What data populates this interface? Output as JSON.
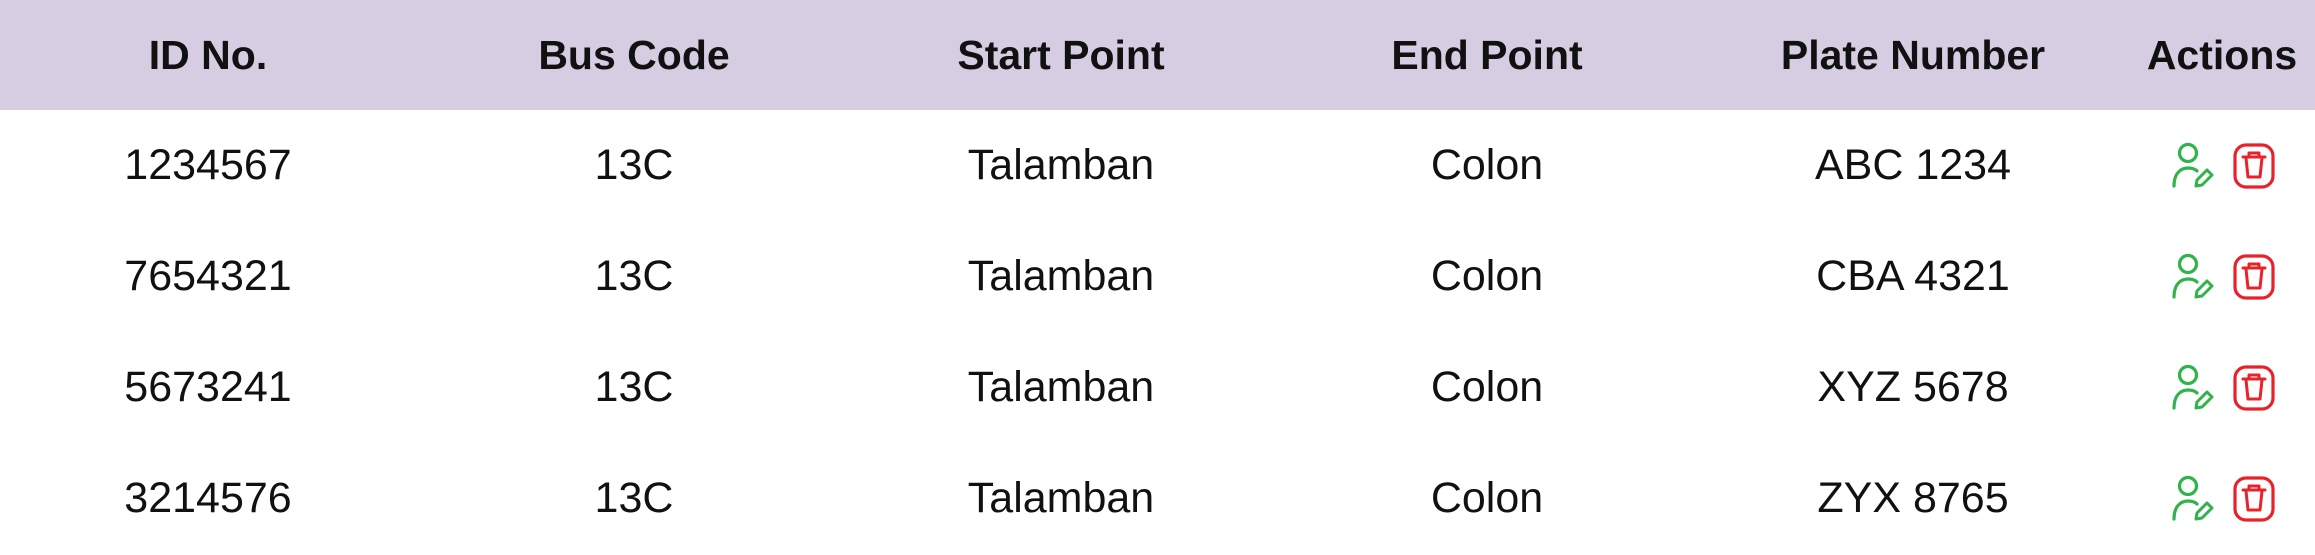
{
  "table": {
    "columns": [
      "ID No.",
      "Bus Code",
      "Start Point",
      "End Point",
      "Plate Number",
      "Actions"
    ],
    "rows": [
      {
        "id": "1234567",
        "bus_code": "13C",
        "start": "Talamban",
        "end": "Colon",
        "plate": "ABC 1234"
      },
      {
        "id": "7654321",
        "bus_code": "13C",
        "start": "Talamban",
        "end": "Colon",
        "plate": "CBA 4321"
      },
      {
        "id": "5673241",
        "bus_code": "13C",
        "start": "Talamban",
        "end": "Colon",
        "plate": "XYZ 5678"
      },
      {
        "id": "3214576",
        "bus_code": "13C",
        "start": "Talamban",
        "end": "Colon",
        "plate": "ZYX 8765"
      }
    ],
    "actions": {
      "edit_icon": "user-edit-icon",
      "delete_icon": "trash-icon"
    }
  },
  "colors": {
    "header_bg": "#d6cde3",
    "edit": "#2fb34a",
    "delete": "#e8222a",
    "text": "#111111"
  }
}
